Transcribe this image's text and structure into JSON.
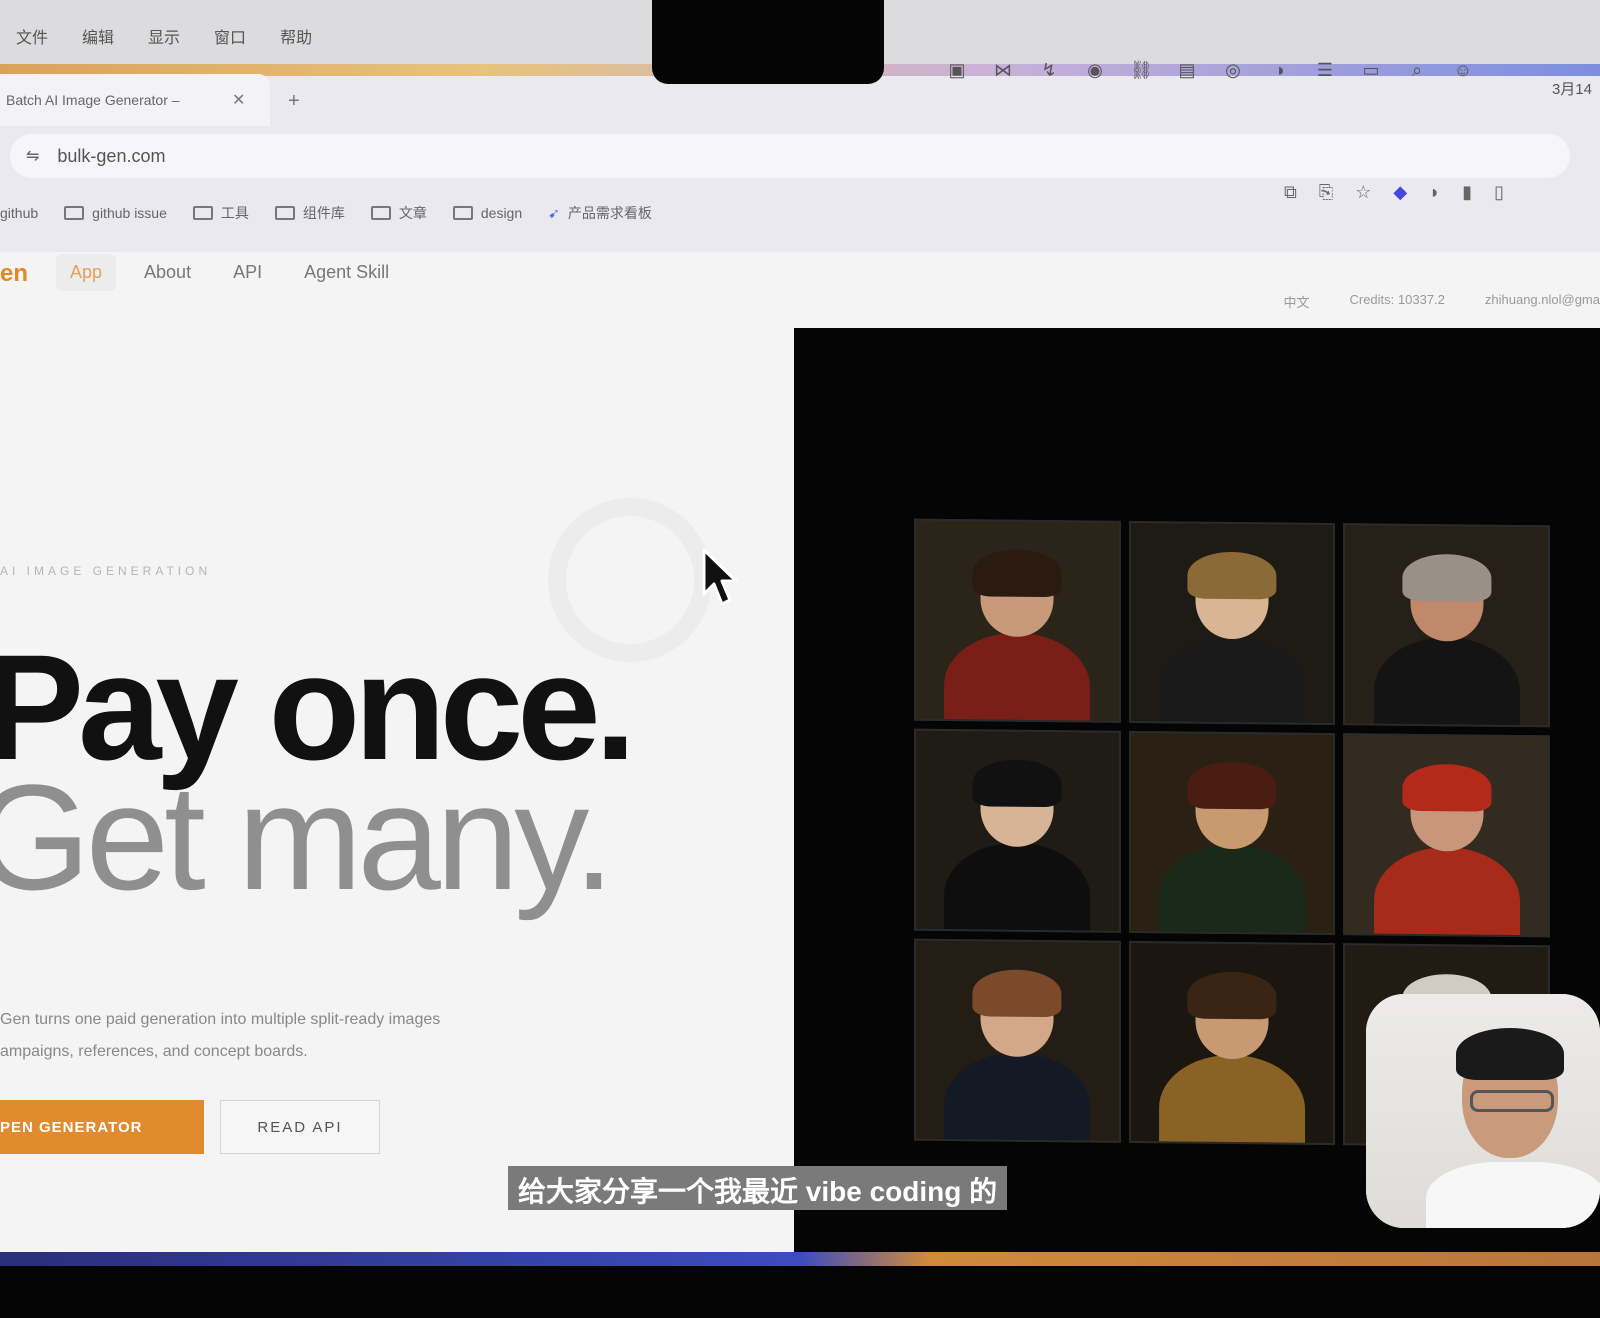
{
  "menubar": {
    "items": [
      "文件",
      "编辑",
      "显示",
      "窗口",
      "帮助"
    ],
    "status_icons": [
      "▣",
      "⋈",
      "↯",
      "◉",
      "⛓",
      "▤",
      "◎",
      "◑",
      "☰",
      "▭",
      "⌕",
      "☺"
    ],
    "clock": "3月14"
  },
  "browser": {
    "tab_title": "Batch AI Image Generator –",
    "tab_close": "✕",
    "new_tab": "+",
    "url": "bulk-gen.com",
    "bookmarks": [
      "github",
      "github issue",
      "工具",
      "组件库",
      "文章",
      "design",
      "产品需求看板"
    ],
    "extensions": [
      "⧉",
      "⎘",
      "☆",
      "◆",
      "◗",
      "▮",
      "▯"
    ]
  },
  "site": {
    "logo": "en",
    "nav": [
      "App",
      "About",
      "API",
      "Agent Skill"
    ],
    "lang": "中文",
    "credits": "Credits: 10337.2",
    "user": "zhihuang.nlol@gma"
  },
  "hero": {
    "eyebrow": "AI IMAGE GENERATION",
    "title_line1": "Pay once.",
    "title_line2": "Get many.",
    "desc_line1": "Gen turns one paid generation into multiple split-ready images",
    "desc_line2": "ampaigns, references, and concept boards.",
    "cta_primary": "PEN GENERATOR",
    "cta_secondary": "READ API"
  },
  "overlay": {
    "subtitle": "给大家分享一个我最近 vibe coding 的"
  },
  "colors": {
    "accent": "#e18b2f",
    "gallery_bg": "#050505"
  }
}
